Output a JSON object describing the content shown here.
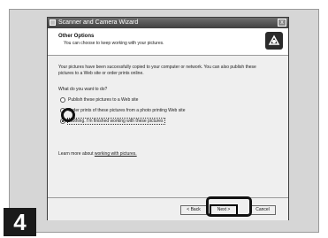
{
  "window": {
    "title": "Scanner and Camera Wizard",
    "close_symbol": "x"
  },
  "header": {
    "title": "Other Options",
    "subtitle": "You can choose to keep working with your pictures."
  },
  "body": {
    "intro": "Your pictures have been successfully copied to your computer or network. You can also publish these pictures to a Web site or order prints online.",
    "question": "What do you want to do?",
    "options": [
      {
        "label": "Publish these pictures to a Web site",
        "checked": false
      },
      {
        "label": "Order prints of these pictures from a photo printing Web site",
        "checked": false
      },
      {
        "label": "Nothing. I'm finished working with these pictures",
        "checked": true
      }
    ],
    "learn_prefix": "Learn more about",
    "learn_link": "working with pictures."
  },
  "footer": {
    "back_label": "< Back",
    "next_label": "Next >",
    "cancel_label": "Cancel"
  },
  "step_number": "4"
}
